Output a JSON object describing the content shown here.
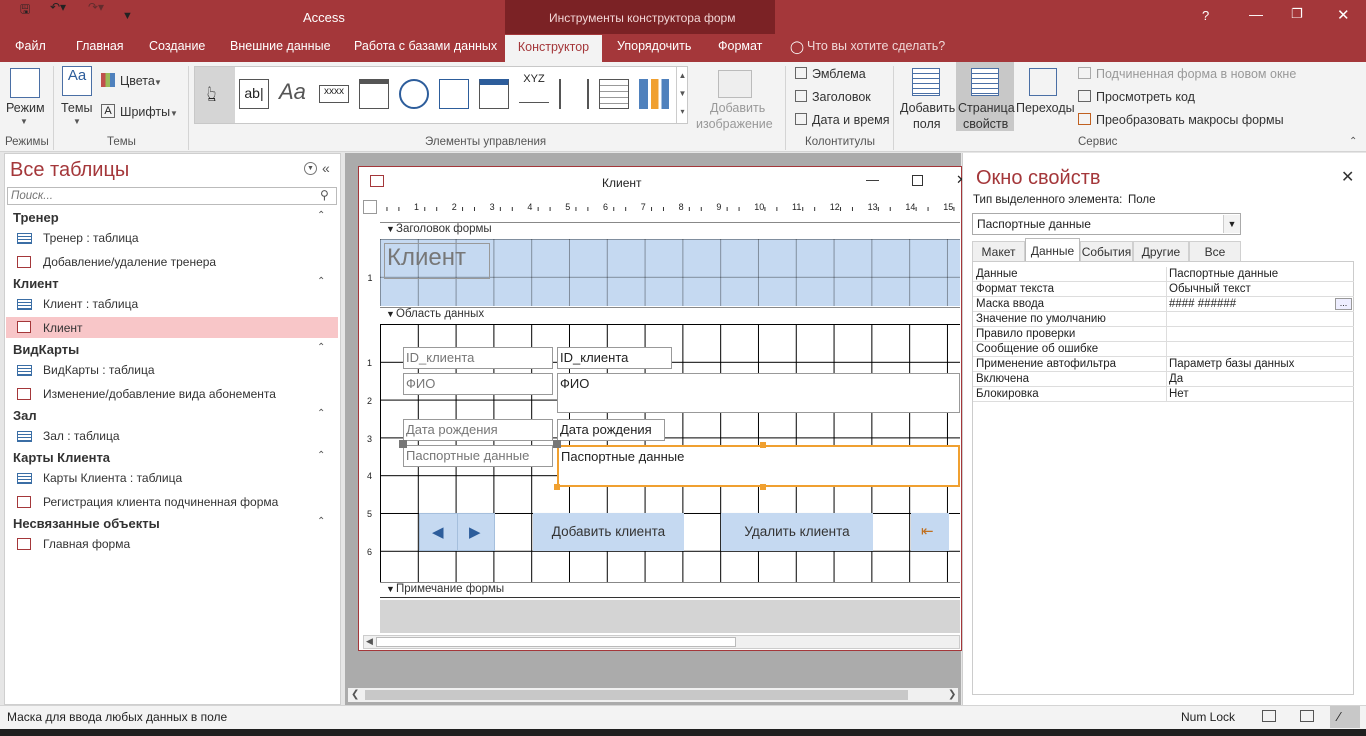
{
  "app": {
    "title": "Access",
    "context_title": "Инструменты конструктора форм",
    "help": "?"
  },
  "tabs": [
    {
      "label": "Файл"
    },
    {
      "label": "Главная"
    },
    {
      "label": "Создание"
    },
    {
      "label": "Внешние данные"
    },
    {
      "label": "Работа с базами данных"
    },
    {
      "label": "Конструктор"
    },
    {
      "label": "Упорядочить"
    },
    {
      "label": "Формат"
    }
  ],
  "tell_me": "Что вы хотите сделать?",
  "ribbon": {
    "mode": "Режим",
    "themes": "Темы",
    "colors": "Цвета",
    "fonts": "Шрифты",
    "insert_image": "Добавить",
    "insert_image2": "изображение",
    "logo": "Эмблема",
    "title": "Заголовок",
    "datetime": "Дата и время",
    "add_field": "Добавить",
    "add_field2": "поля",
    "prop_sheet": "Страница",
    "prop_sheet2": "свойств",
    "tab_order": "Переходы",
    "subform_new_window": "Подчиненная форма в новом окне",
    "view_code": "Просмотреть код",
    "convert_macros": "Преобразовать макросы формы",
    "groups": {
      "views": "Режимы",
      "themes": "Темы",
      "controls": "Элементы управления",
      "header_footer": "Колонтитулы",
      "tools": "Сервис"
    }
  },
  "nav": {
    "title": "Все таблицы",
    "search_placeholder": "Поиск...",
    "sections": [
      {
        "label": "Тренер",
        "items": [
          {
            "label": "Тренер : таблица",
            "type": "table"
          },
          {
            "label": "Добавление/удаление тренера",
            "type": "form"
          }
        ]
      },
      {
        "label": "Клиент",
        "items": [
          {
            "label": "Клиент : таблица",
            "type": "table"
          },
          {
            "label": "Клиент",
            "type": "form",
            "selected": true
          }
        ]
      },
      {
        "label": "ВидКарты",
        "items": [
          {
            "label": "ВидКарты : таблица",
            "type": "table"
          },
          {
            "label": "Изменение/добавление вида абонемента",
            "type": "form"
          }
        ]
      },
      {
        "label": "Зал",
        "items": [
          {
            "label": "Зал : таблица",
            "type": "table"
          }
        ]
      },
      {
        "label": "Карты Клиента",
        "items": [
          {
            "label": "Карты Клиента : таблица",
            "type": "table"
          },
          {
            "label": "Регистрация клиента подчиненная форма",
            "type": "form"
          }
        ]
      },
      {
        "label": "Несвязанные объекты",
        "items": [
          {
            "label": "Главная форма",
            "type": "form"
          }
        ]
      }
    ]
  },
  "form": {
    "title": "Клиент",
    "ruler_ticks": [
      "1",
      "2",
      "3",
      "4",
      "5",
      "6",
      "7",
      "8",
      "9",
      "10",
      "11",
      "12",
      "13",
      "14",
      "15"
    ],
    "vruler_header": [
      "1"
    ],
    "vruler_detail": [
      "1",
      "2",
      "3",
      "4",
      "5",
      "6"
    ],
    "header_section": "Заголовок формы",
    "header_title": "Клиент",
    "detail_section": "Область данных",
    "footer_section": "Примечание формы",
    "labels": {
      "id": "ID_клиента",
      "fio": "ФИО",
      "birth": "Дата рождения",
      "passport": "Паспортные данные"
    },
    "controls": {
      "id": "ID_клиента",
      "fio": "ФИО",
      "birth": "Дата рождения",
      "passport": "Паспортные данные"
    },
    "buttons": {
      "add": "Добавить клиента",
      "delete": "Удалить клиента"
    }
  },
  "props": {
    "title": "Окно свойств",
    "selection_type_label": "Тип выделенного элемента:",
    "selection_type": "Поле",
    "selected_object": "Паспортные данные",
    "tabs": [
      "Макет",
      "Данные",
      "События",
      "Другие",
      "Все"
    ],
    "active_tab": "Данные",
    "rows": [
      {
        "key": "Данные",
        "value": "Паспортные данные"
      },
      {
        "key": "Формат текста",
        "value": "Обычный текст"
      },
      {
        "key": "Маска ввода",
        "value": "#### ######"
      },
      {
        "key": "Значение по умолчанию",
        "value": ""
      },
      {
        "key": "Правило проверки",
        "value": ""
      },
      {
        "key": "Сообщение об ошибке",
        "value": ""
      },
      {
        "key": "Применение автофильтра",
        "value": "Параметр базы данных"
      },
      {
        "key": "Включена",
        "value": "Да"
      },
      {
        "key": "Блокировка",
        "value": "Нет"
      }
    ],
    "ellipsis": "..."
  },
  "status": {
    "message": "Маска для ввода любых данных в поле",
    "numlock": "Num Lock"
  },
  "colors": {
    "accent": "#a4373a",
    "selected_nav": "#f8c6c8",
    "button_face": "#c5d9f1",
    "header_band": "#c5d9f1",
    "selection": "#f0a030"
  }
}
